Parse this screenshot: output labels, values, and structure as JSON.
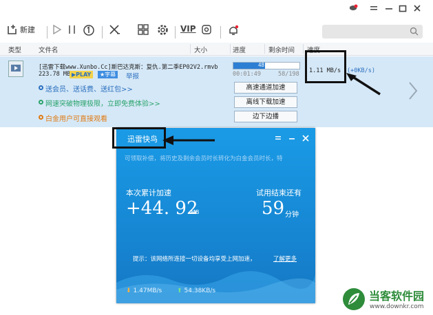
{
  "toolbar": {
    "new_label": "新建",
    "vip_label": "VIP"
  },
  "table": {
    "headers": [
      "类型",
      "文件名",
      "大小",
      "进度",
      "剩余时间",
      "速度"
    ]
  },
  "task": {
    "filename": "[迅雷下载www.Xunbo.Cc]斯巴达克斯：复仇.第二季EP02V2.rmvb",
    "size": "223.78 MB",
    "play_badge": "PLAY",
    "comment_badge": "字幕",
    "report_link": "举报",
    "progress_percent": "48.4%",
    "progress_value": 48.4,
    "elapsed": "00:01:49",
    "count": "58/198",
    "speed": "1.11  MB/s",
    "speed_extra": "(+0KB/s)",
    "links": [
      {
        "text": "送会员、送话费、送红包>>",
        "color": "#2a6fbf"
      },
      {
        "text": "网速突破物理极限，立即免费体验>>",
        "color": "#2aa36b"
      },
      {
        "text": "白金用户可直接观看",
        "color": "#e07a12"
      }
    ],
    "actions": [
      "高速通道加速",
      "离线下载加速",
      "边下边播"
    ]
  },
  "popup": {
    "title": "迅雷快鸟",
    "subtitle": "可领取补偿，将历史及剩余会员时长转化为白金会员时长，特",
    "accel_label": "本次累计加速",
    "accel_value": "+44. 92",
    "accel_unit": "MB",
    "remain_label": "试用结束还有",
    "remain_value": "59",
    "remain_unit": "分钟",
    "tip_text": "提示：该网络所连接一切设备均享受上网加速，",
    "tip_link": "了解更多",
    "down_speed": "1.47MB/s",
    "up_speed": "54.38KB/s"
  },
  "watermark": {
    "title": "当客软件园",
    "url": "www.downkr.com"
  },
  "colors": {
    "selected_row": "#d5e8f7",
    "popup_blue": "#1a8fe0",
    "progress_fill": "#2d7fd4"
  }
}
